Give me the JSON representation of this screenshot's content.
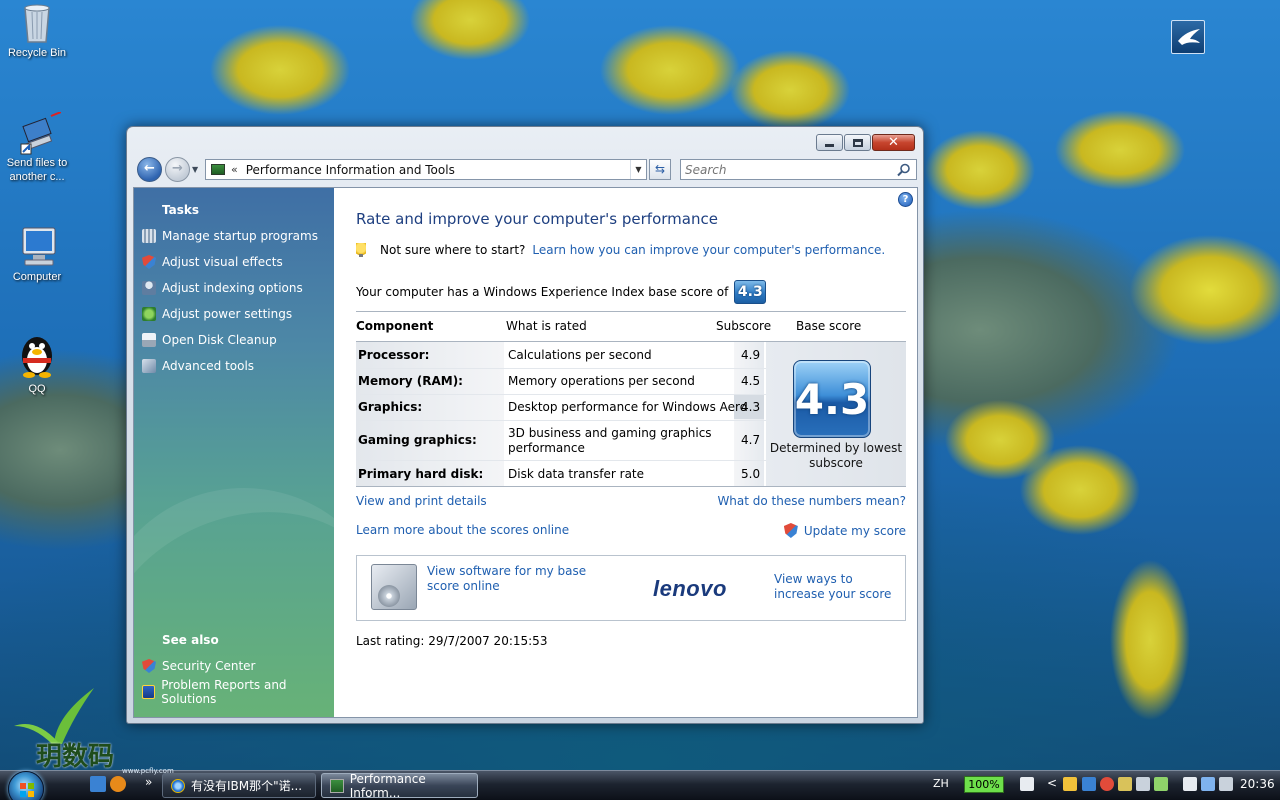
{
  "desktop": {
    "icons": [
      {
        "label": "Recycle Bin",
        "icon": "recycle-bin-icon"
      },
      {
        "label": "Send files to another c...",
        "icon": "send-files-icon"
      },
      {
        "label": "Computer",
        "icon": "computer-icon"
      },
      {
        "label": "QQ",
        "icon": "qq-penguin-icon"
      }
    ],
    "watermark_text": "玥数码",
    "watermark_url": "www.pcfly.com"
  },
  "window": {
    "address_chevron": "«",
    "address_text": "Performance Information and Tools",
    "search_placeholder": "Search",
    "help_glyph": "?"
  },
  "tasks": {
    "heading": "Tasks",
    "items": [
      {
        "label": "Manage startup programs",
        "icon": "startup-grid-icon"
      },
      {
        "label": "Adjust visual effects",
        "icon": "shield-icon"
      },
      {
        "label": "Adjust indexing options",
        "icon": "indexing-icon"
      },
      {
        "label": "Adjust power settings",
        "icon": "power-icon"
      },
      {
        "label": "Open Disk Cleanup",
        "icon": "disk-cleanup-icon"
      },
      {
        "label": "Advanced tools",
        "icon": "tools-icon"
      }
    ],
    "see_also_heading": "See also",
    "see_also": [
      {
        "label": "Security Center",
        "icon": "shield-icon"
      },
      {
        "label": "Problem Reports and Solutions",
        "icon": "problem-reports-icon"
      }
    ]
  },
  "main": {
    "title": "Rate and improve your computer's performance",
    "tip_prefix": "Not sure where to start?",
    "tip_link": "Learn how you can improve your computer's performance.",
    "wei_text": "Your computer has a Windows Experience Index base score of",
    "base_score": "4.3",
    "table": {
      "headers": {
        "component": "Component",
        "what": "What is rated",
        "subscore": "Subscore",
        "base": "Base score"
      },
      "rows": [
        {
          "component": "Processor:",
          "what": "Calculations per second",
          "subscore": "4.9"
        },
        {
          "component": "Memory (RAM):",
          "what": "Memory operations per second",
          "subscore": "4.5"
        },
        {
          "component": "Graphics:",
          "what": "Desktop performance for Windows Aero",
          "subscore": "4.3"
        },
        {
          "component": "Gaming graphics:",
          "what": "3D business and gaming graphics performance",
          "subscore": "4.7"
        },
        {
          "component": "Primary hard disk:",
          "what": "Disk data transfer rate",
          "subscore": "5.0"
        }
      ],
      "base_caption": "Determined by lowest subscore"
    },
    "link_view_print": "View and print details",
    "link_numbers_mean": "What do these numbers mean?",
    "link_learn_more": "Learn more about the scores online",
    "link_update": "Update my score",
    "offer_left": "View software for my base score online",
    "offer_brand": "lenovo",
    "offer_right": "View ways to increase your score",
    "last_rating": "Last rating: 29/7/2007 20:15:53"
  },
  "taskbar": {
    "buttons": [
      {
        "label": "有没有IBM那个\"诺...",
        "active": false
      },
      {
        "label": "Performance Inform...",
        "active": true
      }
    ],
    "overflow_glyph": "»",
    "language": "ZH",
    "battery": "100%",
    "tray_chevron": "<",
    "clock": "20:36"
  },
  "colors": {
    "link": "#1f5fb0",
    "title": "#1e3f80",
    "score_badge": "#2f7cc5",
    "battery": "#6ee04b"
  }
}
